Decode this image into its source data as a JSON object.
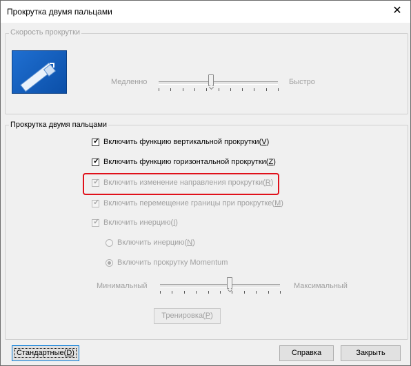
{
  "window": {
    "title": "Прокрутка двумя пальцами",
    "close_icon": "close-icon"
  },
  "speed_group": {
    "legend": "Скорость прокрутки",
    "slow_label": "Медленно",
    "fast_label": "Быстро",
    "slider_value_fraction": 0.44
  },
  "scroll_group": {
    "legend": "Прокрутка двумя пальцами",
    "vertical": {
      "label": "Включить функцию вертикальной прокрутки(",
      "key": "V",
      "end": ")",
      "checked": true,
      "enabled": true
    },
    "horizontal": {
      "label": "Включить функцию горизонтальной прокрутки(",
      "key": "Z",
      "end": ")",
      "checked": true,
      "enabled": true
    },
    "reverse": {
      "label": "Включить изменение направления прокрутки(",
      "key": "R",
      "end": ")",
      "checked": true,
      "enabled": false
    },
    "edge": {
      "label": "Включить перемещение границы при прокрутке(",
      "key": "M",
      "end": ")",
      "checked": true,
      "enabled": false
    },
    "inertia": {
      "label": "Включить инерцию(",
      "key": "I",
      "end": ")",
      "checked": true,
      "enabled": false
    },
    "radio_inertia": {
      "label": "Включить инерцию(",
      "key": "N",
      "end": ")",
      "selected": false
    },
    "radio_momentum": {
      "label": "Включить прокрутку Momentum",
      "selected": true
    },
    "min_label": "Минимальный",
    "max_label": "Максимальный",
    "inertia_slider_fraction": 0.58,
    "training_button": {
      "label": "Тренировка(",
      "key": "P",
      "end": ")"
    }
  },
  "footer": {
    "defaults_button": {
      "label": "Стандартные(",
      "key": "D",
      "end": ")"
    },
    "help_button": "Справка",
    "close_button": "Закрыть"
  },
  "colors": {
    "highlight": "#e0101a",
    "accent": "#0078d7"
  }
}
